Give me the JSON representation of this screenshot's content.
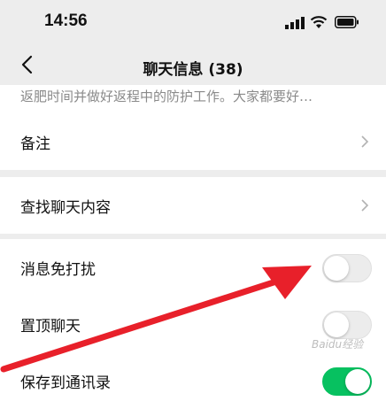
{
  "status_bar": {
    "time": "14:56"
  },
  "nav": {
    "title": "聊天信息 (38)"
  },
  "notice": {
    "text": "返肥时间并做好返程中的防护工作。大家都要好…"
  },
  "rows": {
    "remark": {
      "label": "备注"
    },
    "search": {
      "label": "查找聊天内容"
    },
    "mute": {
      "label": "消息免打扰",
      "enabled": false
    },
    "pin": {
      "label": "置顶聊天",
      "enabled": false
    },
    "save": {
      "label": "保存到通讯录",
      "enabled": true
    }
  },
  "annotation": {
    "arrow_color": "#e8202a"
  },
  "watermark": {
    "text": "Baidu经验"
  },
  "colors": {
    "background": "#ededed",
    "card": "#ffffff",
    "toggle_on": "#07c160",
    "toggle_off": "#ececec"
  },
  "icons": [
    "back-chevron-icon",
    "chevron-right-icon",
    "signal-icon",
    "wifi-icon",
    "battery-icon"
  ]
}
